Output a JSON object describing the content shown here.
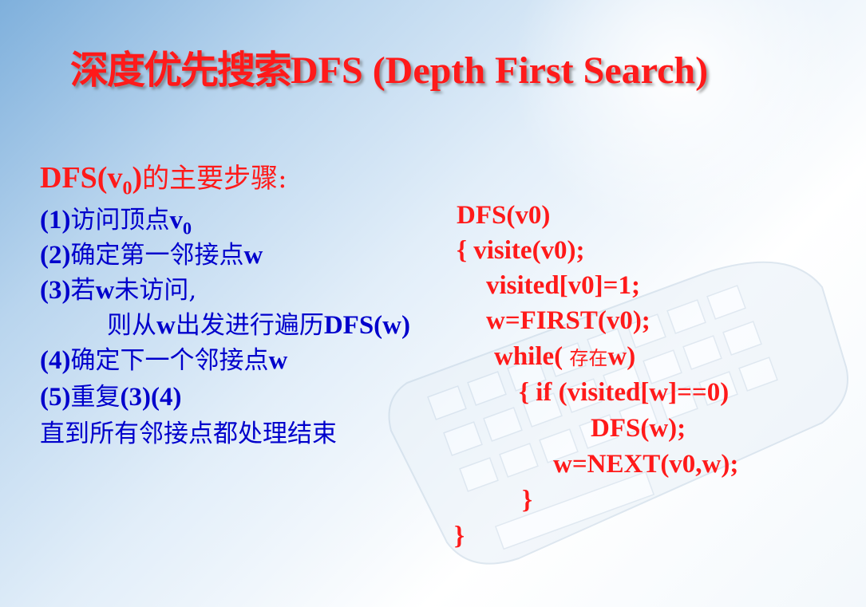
{
  "title": {
    "cn": "深度优先搜索",
    "en": "DFS (Depth First Search)"
  },
  "steps_heading": {
    "prefix": "DFS(v",
    "sub": "0",
    "suffix": ")",
    "cn": "的主要步骤:"
  },
  "steps": [
    {
      "num": "(1)",
      "text": "访问顶点",
      "latin": "v",
      "sub": "0"
    },
    {
      "num": "(2)",
      "text": "确定第一邻接点",
      "latin": "w"
    },
    {
      "num": "(3)",
      "text": "若",
      "latin": "w",
      "text2": "未访问,"
    },
    {
      "text": "则从",
      "latin": "w",
      "text2": "出发进行遍历",
      "latin2": "DFS(w)"
    },
    {
      "num": "(4)",
      "text": "确定下一个邻接点",
      "latin": "w"
    },
    {
      "num": "(5)",
      "text": "重复",
      "latin": "(3)(4)"
    },
    {
      "text": "直到所有邻接点都处理结束"
    }
  ],
  "code": [
    "DFS(v0)",
    "{  visite(v0);",
    "visited[v0]=1;",
    "w=FIRST(v0);",
    {
      "a": "while( ",
      "cn": "存在",
      "b": "w)"
    },
    "{   if  (visited[w]==0)",
    "DFS(w);",
    "w=NEXT(v0,w);",
    "}",
    "}"
  ]
}
